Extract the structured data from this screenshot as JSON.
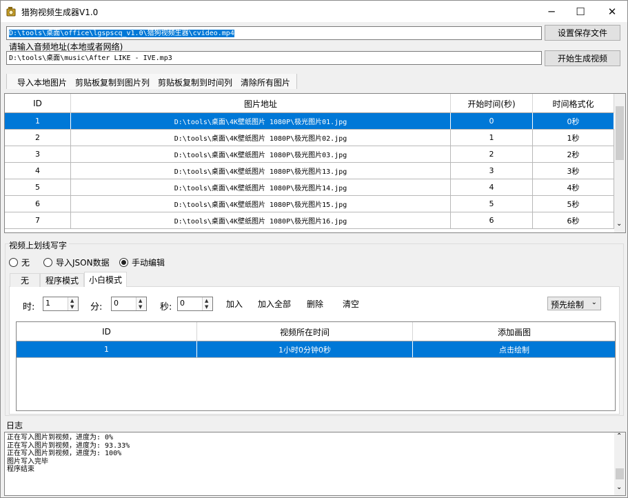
{
  "window": {
    "title": "猎狗视频生成器V1.0",
    "icon": "app-icon",
    "min_glyph": "─",
    "max_glyph": "☐",
    "close_glyph": "✕"
  },
  "output": {
    "path": "D:\\tools\\桌面\\office\\lgspscq_v1.0\\猎狗视频生器\\cvideo.mp4",
    "button": "设置保存文件"
  },
  "audio": {
    "label": "请输入音频地址(本地或者网络)",
    "path": "D:\\tools\\桌面\\music\\After LIKE - IVE.mp3",
    "button": "开始生成视频"
  },
  "toolbar": {
    "items": [
      "导入本地图片",
      "剪贴板复制到图片列",
      "剪贴板复制到时间列",
      "清除所有图片"
    ]
  },
  "images_table": {
    "columns": [
      "ID",
      "图片地址",
      "开始时间(秒)",
      "时间格式化"
    ],
    "rows": [
      {
        "id": "1",
        "path": "D:\\tools\\桌面\\4K壁纸图片 1080P\\极光图片01.jpg",
        "start": "0",
        "fmt": "0秒",
        "selected": true
      },
      {
        "id": "2",
        "path": "D:\\tools\\桌面\\4K壁纸图片 1080P\\极光图片02.jpg",
        "start": "1",
        "fmt": "1秒",
        "selected": false
      },
      {
        "id": "3",
        "path": "D:\\tools\\桌面\\4K壁纸图片 1080P\\极光图片03.jpg",
        "start": "2",
        "fmt": "2秒",
        "selected": false
      },
      {
        "id": "4",
        "path": "D:\\tools\\桌面\\4K壁纸图片 1080P\\极光图片13.jpg",
        "start": "3",
        "fmt": "3秒",
        "selected": false
      },
      {
        "id": "5",
        "path": "D:\\tools\\桌面\\4K壁纸图片 1080P\\极光图片14.jpg",
        "start": "4",
        "fmt": "4秒",
        "selected": false
      },
      {
        "id": "6",
        "path": "D:\\tools\\桌面\\4K壁纸图片 1080P\\极光图片15.jpg",
        "start": "5",
        "fmt": "5秒",
        "selected": false
      },
      {
        "id": "7",
        "path": "D:\\tools\\桌面\\4K壁纸图片 1080P\\极光图片16.jpg",
        "start": "6",
        "fmt": "6秒",
        "selected": false
      }
    ]
  },
  "overlay_section": {
    "label": "视频上划线写字",
    "radios": [
      {
        "label": "无",
        "checked": false
      },
      {
        "label": "导入JSON数据",
        "checked": false
      },
      {
        "label": "手动编辑",
        "checked": true
      }
    ],
    "tabs": [
      {
        "label": "无",
        "active": false
      },
      {
        "label": "程序模式",
        "active": false
      },
      {
        "label": "小白模式",
        "active": true
      }
    ],
    "hour_label": "时:",
    "hour_value": "1",
    "minute_label": "分:",
    "minute_value": "0",
    "second_label": "秒:",
    "second_value": "0",
    "actions": [
      "加入",
      "加入全部",
      "删除",
      "清空"
    ],
    "preset": "预先绘制",
    "table": {
      "columns": [
        "ID",
        "视频所在时间",
        "添加画图"
      ],
      "rows": [
        {
          "id": "1",
          "time": "1小时0分钟0秒",
          "action": "点击绘制",
          "selected": true
        }
      ]
    }
  },
  "log": {
    "label": "日志",
    "lines": [
      "正在写入图片到视频，进度为: 0%",
      "正在写入图片到视频，进度为: 93.33%",
      "正在写入图片到视频，进度为: 100%",
      "图片写入完毕",
      "程序结束"
    ]
  }
}
